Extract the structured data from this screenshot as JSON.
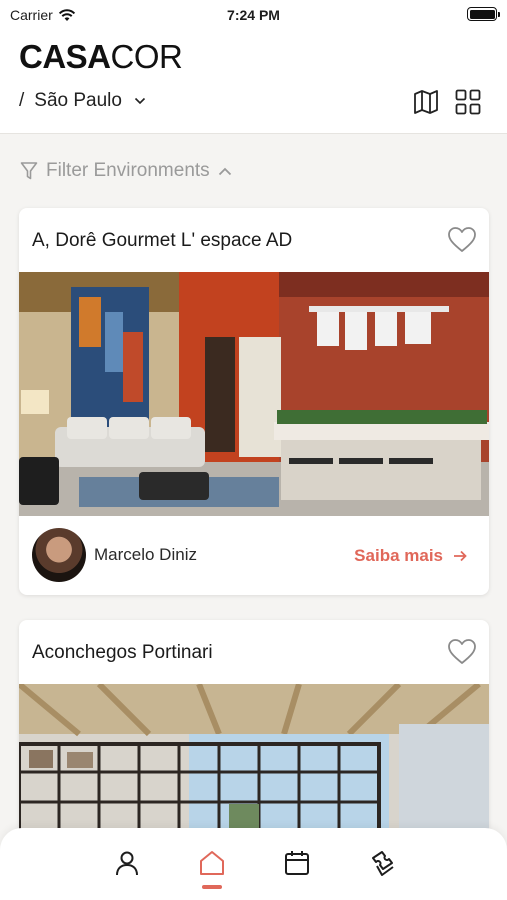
{
  "status_bar": {
    "carrier": "Carrier",
    "time": "7:24 PM"
  },
  "header": {
    "logo_bold": "CASA",
    "logo_light": "COR",
    "city_prefix": "/",
    "city": "São Paulo"
  },
  "filter": {
    "label": "Filter Environments"
  },
  "cards": [
    {
      "title": "A, Dorê Gourmet L' espace AD",
      "author": "Marcelo Diniz",
      "cta": "Saiba mais"
    },
    {
      "title": "Aconchegos Portinari"
    }
  ],
  "tabbar": {
    "items": [
      "profile-icon",
      "home-icon",
      "calendar-icon",
      "tickets-icon"
    ],
    "active": "home-icon"
  },
  "colors": {
    "accent": "#e0685a",
    "muted": "#9a9a9a",
    "background": "#f5f4f2"
  }
}
